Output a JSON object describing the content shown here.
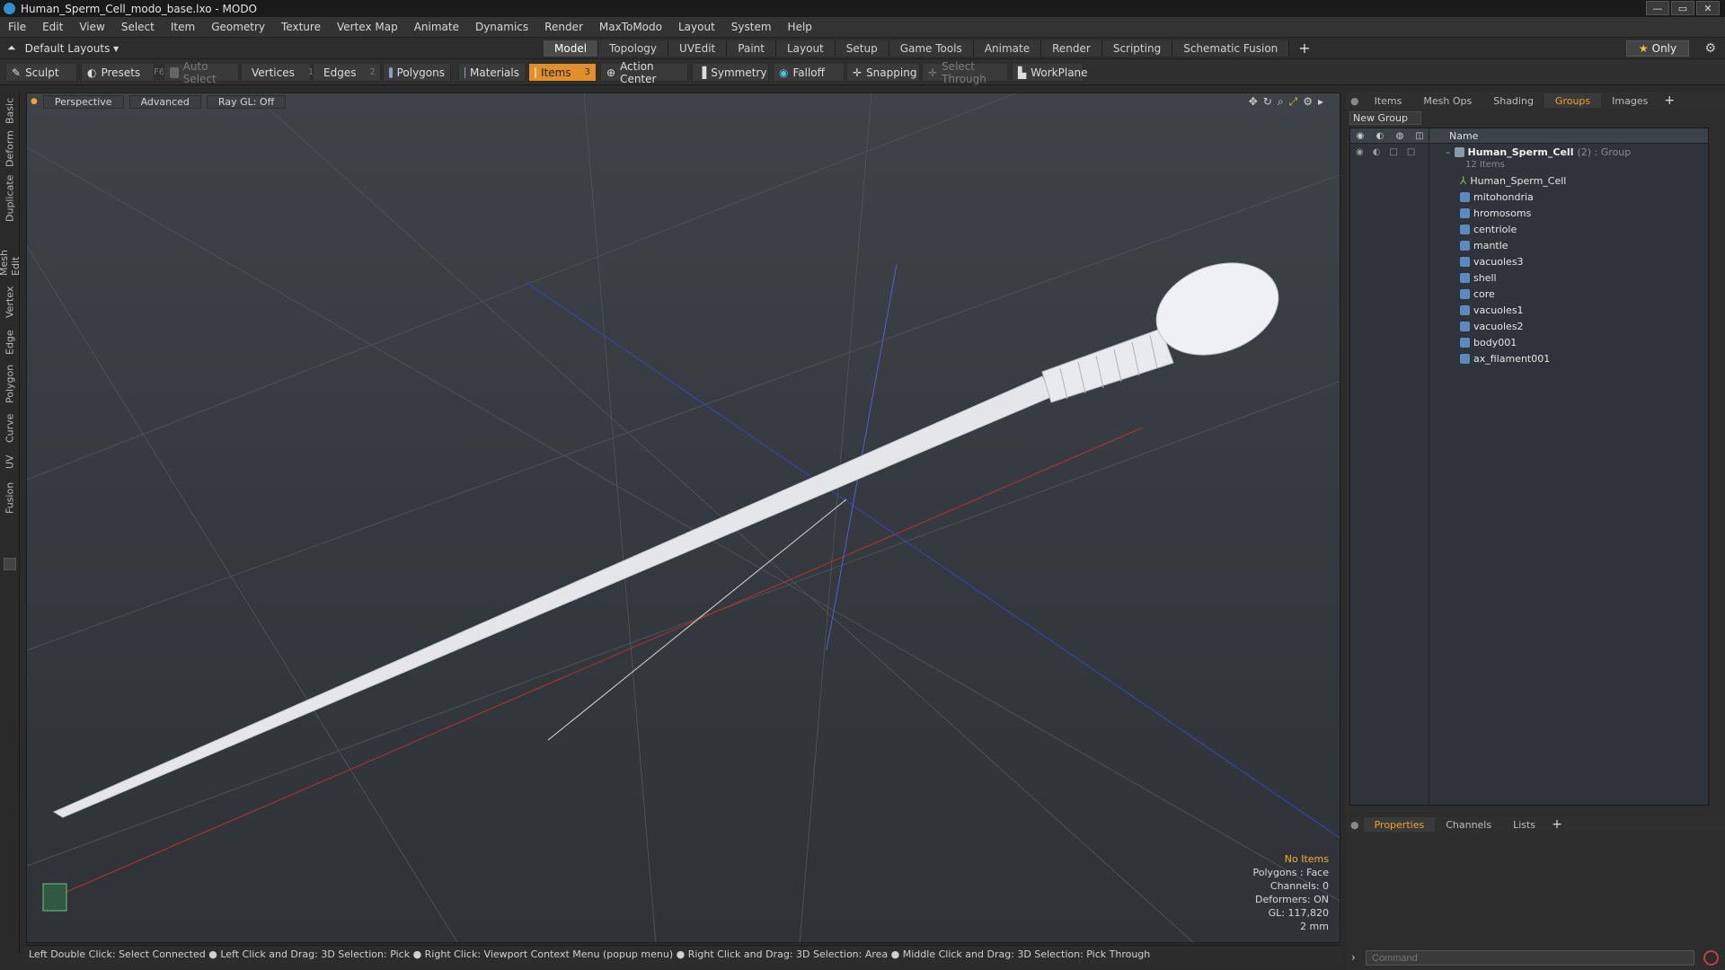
{
  "window": {
    "title": "Human_Sperm_Cell_modo_base.lxo - MODO",
    "controls": [
      "—",
      "▭",
      "✕"
    ]
  },
  "menu": [
    "File",
    "Edit",
    "View",
    "Select",
    "Item",
    "Geometry",
    "Texture",
    "Vertex Map",
    "Animate",
    "Dynamics",
    "Render",
    "MaxToModo",
    "Layout",
    "System",
    "Help"
  ],
  "layout": {
    "preset": "Default Layouts ▾",
    "tabs": [
      "Model",
      "Topology",
      "UVEdit",
      "Paint",
      "Layout",
      "Setup",
      "Game Tools",
      "Animate",
      "Render",
      "Scripting",
      "Schematic Fusion"
    ],
    "active_tab": "Model",
    "plus": "+",
    "only_label": "Only",
    "only_star": "★",
    "gear": "⚙"
  },
  "toolbar": {
    "sculpt": "Sculpt",
    "presets": "Presets",
    "presets_key": "F6",
    "auto_select": "Auto Select",
    "vertices": "Vertices",
    "vertices_count": "1",
    "edges": "Edges",
    "edges_count": "2",
    "polygons": "Polygons",
    "materials": "Materials",
    "items": "Items",
    "items_count": "3",
    "action_center": "Action Center",
    "symmetry": "Symmetry",
    "falloff": "Falloff",
    "snapping": "Snapping",
    "select_through": "Select Through",
    "workplane": "WorkPlane"
  },
  "left_tabs": [
    "Basic",
    "Deform",
    "Duplicate",
    "Mesh Edit",
    "Vertex",
    "Edge",
    "Polygon",
    "Curve",
    "UV",
    "Fusion"
  ],
  "viewport": {
    "view": "Perspective",
    "advanced": "Advanced",
    "raygl": "Ray GL: Off",
    "info": {
      "items": "No Items",
      "polygons": "Polygons : Face",
      "channels": "Channels: 0",
      "deformers": "Deformers: ON",
      "gl": "GL: 117,820",
      "scale": "2 mm"
    }
  },
  "status_bar": "Left Double Click: Select Connected ● Left Click and Drag: 3D Selection: Pick ● Right Click: Viewport Context Menu (popup menu) ● Right Click and Drag: 3D Selection: Area ● Middle Click and Drag: 3D Selection: Pick Through",
  "right_panel": {
    "tabs": [
      "Items",
      "Mesh Ops",
      "Shading",
      "Groups",
      "Images"
    ],
    "active_tab": "Groups",
    "plus": "+",
    "new_group": "New Group",
    "name_header": "Name",
    "group": {
      "name": "Human_Sperm_Cell",
      "meta": "(2) : Group",
      "count": "12 Items"
    },
    "items": [
      "Human_Sperm_Cell",
      "mitohondria",
      "hromosoms",
      "centriole",
      "mantle",
      "vacuoles3",
      "shell",
      "core",
      "vacuoles1",
      "vacuoles2",
      "body001",
      "ax_filament001"
    ],
    "props_tabs": [
      "Properties",
      "Channels",
      "Lists"
    ],
    "props_active": "Properties",
    "command_placeholder": "Command"
  },
  "colors": {
    "accent": "#e0902a",
    "active_tab_text": "#f0a030",
    "x_axis": "#c03030",
    "z_axis": "#3040c0"
  }
}
